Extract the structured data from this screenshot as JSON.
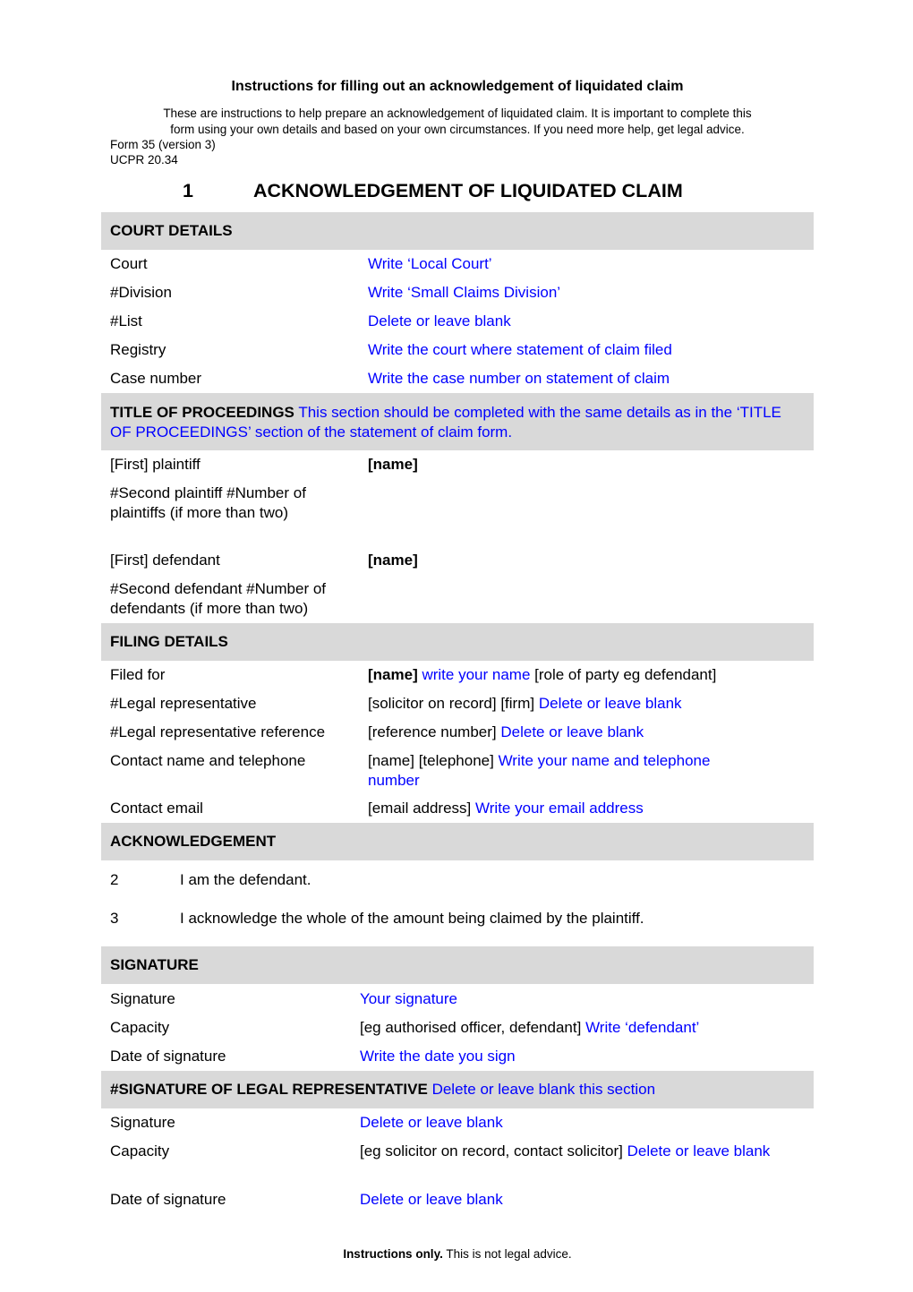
{
  "document": {
    "title": "Instructions for filling out an acknowledgement of liquidated claim",
    "intro_line1": "These are instructions to help prepare an acknowledgement of liquidated claim. It is important to complete this",
    "intro_line2": "form using your own details and based on your own circumstances. If you need more help, get legal advice.",
    "form_number": "Form 35 (version 3)",
    "rule": "UCPR 20.34",
    "heading_number": "1",
    "heading_text": "ACKNOWLEDGEMENT OF LIQUIDATED CLAIM"
  },
  "court_details": {
    "title": "COURT DETAILS",
    "rows": [
      {
        "label": "Court",
        "value": "Write ‘Local Court’"
      },
      {
        "label": "#Division",
        "value": "Write ‘Small Claims Division’"
      },
      {
        "label": "#List",
        "value": "Delete or leave blank"
      },
      {
        "label": "Registry",
        "value": "Write the court where statement of claim filed"
      },
      {
        "label": "Case number",
        "value": "Write the case number on statement of claim"
      }
    ]
  },
  "title_of_proceedings": {
    "title": "TITLE OF PROCEEDINGS",
    "note": "This section should be completed with the same details as in the ‘TITLE OF PROCEEDINGS’ section of the statement of claim form.",
    "rows": [
      {
        "label": "[First] plaintiff",
        "value": "[name]"
      },
      {
        "label": "#Second plaintiff #Number of plaintiffs (if more than two)",
        "value": ""
      },
      {
        "label": "[First] defendant",
        "value": "[name]"
      },
      {
        "label": "#Second defendant #Number of defendants (if more than two)",
        "value": ""
      }
    ]
  },
  "filing_details": {
    "title": "FILING DETAILS",
    "rows": [
      {
        "label": "Filed for",
        "bold": "[name]",
        "hint": "write your name",
        "suffix": "[role of party eg defendant]"
      },
      {
        "label": "#Legal representative",
        "prefix": "[solicitor on record] [firm]",
        "hint": "Delete or leave blank"
      },
      {
        "label": "#Legal representative reference",
        "prefix": "[reference number]",
        "hint": "Delete or leave blank"
      },
      {
        "label": "Contact name and telephone",
        "prefix": "[name] [telephone]",
        "hint": "Write your name and telephone number"
      },
      {
        "label": "Contact email",
        "prefix": "[email address]",
        "hint": "Write your email address"
      }
    ]
  },
  "acknowledgement": {
    "title": "ACKNOWLEDGEMENT",
    "paragraphs": [
      {
        "number": "2",
        "text": "I am the defendant."
      },
      {
        "number": "3",
        "text": "I acknowledge the whole of the amount being claimed by the plaintiff."
      }
    ]
  },
  "signature": {
    "title": "SIGNATURE",
    "rows": [
      {
        "label": "Signature",
        "prefix": "",
        "hint": "Your signature"
      },
      {
        "label": "Capacity",
        "prefix": "[eg authorised officer, defendant]",
        "hint": "Write ‘defendant’"
      },
      {
        "label": "Date of signature",
        "prefix": "",
        "hint": "Write the date you sign"
      }
    ]
  },
  "legal_rep_signature": {
    "title": "#SIGNATURE OF LEGAL REPRESENTATIVE",
    "note": "Delete or leave blank this section",
    "rows": [
      {
        "label": "Signature",
        "prefix": "",
        "hint": "Delete or leave blank"
      },
      {
        "label": "Capacity",
        "prefix": "[eg solicitor on record, contact solicitor]",
        "hint": "Delete or leave blank"
      },
      {
        "label": "Date of signature",
        "prefix": "",
        "hint": "Delete or leave blank"
      }
    ]
  },
  "footer": {
    "bold": "Instructions only.",
    "text": "This is not legal advice."
  },
  "colors": {
    "band": "#d9d9d9",
    "instruction_text": "#0000ff",
    "body_text": "#000000"
  }
}
